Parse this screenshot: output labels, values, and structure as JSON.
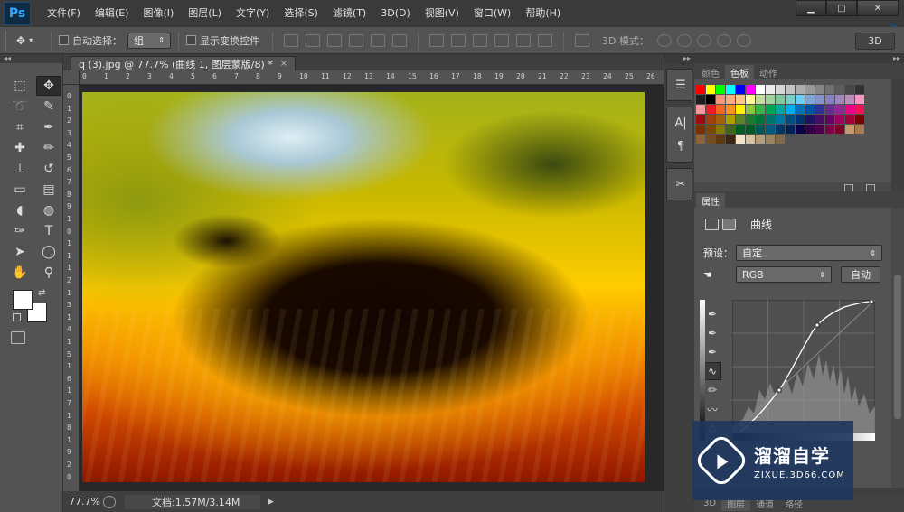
{
  "app": {
    "logo": "Ps"
  },
  "menu": [
    "文件(F)",
    "编辑(E)",
    "图像(I)",
    "图层(L)",
    "文字(Y)",
    "选择(S)",
    "滤镜(T)",
    "3D(D)",
    "视图(V)",
    "窗口(W)",
    "帮助(H)"
  ],
  "window_controls": {
    "minimize": "▁",
    "maximize": "□",
    "close": "✕"
  },
  "options": {
    "tool_preset_icon": "move-icon",
    "auto_select_label": "自动选择：",
    "auto_select_value": "组",
    "show_transform_label": "显示变换控件",
    "mode3d_label": "3D 模式：",
    "workspace": "3D"
  },
  "document": {
    "tab_title": "q (3).jpg @ 77.7% (曲线 1, 图层蒙版/8) *",
    "close": "×",
    "zoom": "77.7%",
    "doc_info": "文档:1.57M/3.14M",
    "status_arrow": "▶"
  },
  "ruler": {
    "h_ticks": [
      "0",
      "1",
      "2",
      "3",
      "4",
      "5",
      "6",
      "7",
      "8",
      "9",
      "10",
      "11",
      "12",
      "13",
      "14",
      "15",
      "16",
      "17",
      "18",
      "19",
      "20",
      "21",
      "22",
      "23",
      "24",
      "25",
      "26"
    ],
    "v_ticks": [
      "0",
      "1",
      "2",
      "3",
      "4",
      "5",
      "6",
      "7",
      "8",
      "9",
      "1",
      "0",
      "1",
      "1",
      "1",
      "2",
      "1",
      "3",
      "1",
      "4",
      "1",
      "5",
      "1",
      "6",
      "1",
      "7",
      "1",
      "8",
      "1",
      "9",
      "2",
      "0"
    ]
  },
  "tools": [
    {
      "name": "marquee-tool",
      "glyph": "⬚"
    },
    {
      "name": "move-tool",
      "glyph": "✥"
    },
    {
      "name": "lasso-tool",
      "glyph": "➰"
    },
    {
      "name": "quick-select-tool",
      "glyph": "✎"
    },
    {
      "name": "crop-tool",
      "glyph": "⌗"
    },
    {
      "name": "eyedropper-tool",
      "glyph": "✒"
    },
    {
      "name": "healing-brush-tool",
      "glyph": "✚"
    },
    {
      "name": "brush-tool",
      "glyph": "✏"
    },
    {
      "name": "clone-stamp-tool",
      "glyph": "⊥"
    },
    {
      "name": "history-brush-tool",
      "glyph": "↺"
    },
    {
      "name": "eraser-tool",
      "glyph": "▭"
    },
    {
      "name": "gradient-tool",
      "glyph": "▤"
    },
    {
      "name": "blur-tool",
      "glyph": "◖"
    },
    {
      "name": "dodge-tool",
      "glyph": "◍"
    },
    {
      "name": "pen-tool",
      "glyph": "✑"
    },
    {
      "name": "type-tool",
      "glyph": "T"
    },
    {
      "name": "path-select-tool",
      "glyph": "➤"
    },
    {
      "name": "ellipse-tool",
      "glyph": "◯"
    },
    {
      "name": "hand-tool",
      "glyph": "✋"
    },
    {
      "name": "zoom-tool",
      "glyph": "⚲"
    }
  ],
  "panels": {
    "swatch_tabs": [
      "颜色",
      "色板",
      "动作"
    ],
    "swatches": [
      "#ff0000",
      "#ffff00",
      "#00ff00",
      "#00ffff",
      "#0000ff",
      "#ff00ff",
      "#ffffff",
      "#ebebeb",
      "#d6d6d6",
      "#c2c2c2",
      "#adadad",
      "#999999",
      "#858585",
      "#707070",
      "#5c5c5c",
      "#474747",
      "#333333",
      "#1f1f1f",
      "#000000",
      "#f7977a",
      "#f9ad81",
      "#fdc68a",
      "#fff79a",
      "#c4df9b",
      "#a3d39c",
      "#82ca9d",
      "#7bcdc8",
      "#6ecff6",
      "#7ea7d8",
      "#8493ca",
      "#8882be",
      "#a187be",
      "#bc8dbf",
      "#f49ac2",
      "#f6989d",
      "#ed1c24",
      "#f26522",
      "#f7941d",
      "#fff200",
      "#8dc63f",
      "#39b54a",
      "#00a651",
      "#00a99d",
      "#00aeef",
      "#0072bc",
      "#0054a6",
      "#2e3192",
      "#662d91",
      "#92278f",
      "#ec008c",
      "#ed145b",
      "#9e0b0f",
      "#a0410d",
      "#a36209",
      "#aba000",
      "#598527",
      "#1a7b30",
      "#007236",
      "#00746b",
      "#0076a3",
      "#004b80",
      "#003471",
      "#1b1464",
      "#440e62",
      "#630460",
      "#9e005d",
      "#9e0039",
      "#790000",
      "#7b2e00",
      "#7d4900",
      "#827b00",
      "#406618",
      "#005e20",
      "#005826",
      "#005952",
      "#005b7f",
      "#003663",
      "#002157",
      "#0d004c",
      "#32004b",
      "#4b0049",
      "#7b0046",
      "#7a0026",
      "#c69c6d",
      "#a67c52",
      "#8c6239",
      "#754c24",
      "#603913",
      "#3c2415",
      "#f2e3c6",
      "#d6c3a0",
      "#b59e7a",
      "#9b8362",
      "#826b4a"
    ],
    "props_tab": "属性",
    "adj_title": "曲线",
    "preset_label": "预设：",
    "preset_value": "自定",
    "channel_value": "RGB",
    "auto_label": "自动",
    "layers_tabs": [
      "3D",
      "图层",
      "通道",
      "路径"
    ]
  },
  "watermark": {
    "main": "溜溜自学",
    "sub": "ZIXUE.3D66.COM"
  }
}
